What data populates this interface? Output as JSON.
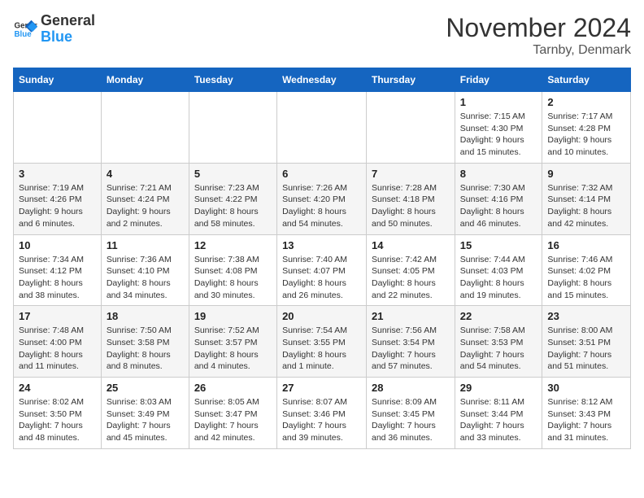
{
  "header": {
    "logo_general": "General",
    "logo_blue": "Blue",
    "month": "November 2024",
    "location": "Tarnby, Denmark"
  },
  "days_of_week": [
    "Sunday",
    "Monday",
    "Tuesday",
    "Wednesday",
    "Thursday",
    "Friday",
    "Saturday"
  ],
  "weeks": [
    [
      {
        "day": "",
        "info": ""
      },
      {
        "day": "",
        "info": ""
      },
      {
        "day": "",
        "info": ""
      },
      {
        "day": "",
        "info": ""
      },
      {
        "day": "",
        "info": ""
      },
      {
        "day": "1",
        "info": "Sunrise: 7:15 AM\nSunset: 4:30 PM\nDaylight: 9 hours and 15 minutes."
      },
      {
        "day": "2",
        "info": "Sunrise: 7:17 AM\nSunset: 4:28 PM\nDaylight: 9 hours and 10 minutes."
      }
    ],
    [
      {
        "day": "3",
        "info": "Sunrise: 7:19 AM\nSunset: 4:26 PM\nDaylight: 9 hours and 6 minutes."
      },
      {
        "day": "4",
        "info": "Sunrise: 7:21 AM\nSunset: 4:24 PM\nDaylight: 9 hours and 2 minutes."
      },
      {
        "day": "5",
        "info": "Sunrise: 7:23 AM\nSunset: 4:22 PM\nDaylight: 8 hours and 58 minutes."
      },
      {
        "day": "6",
        "info": "Sunrise: 7:26 AM\nSunset: 4:20 PM\nDaylight: 8 hours and 54 minutes."
      },
      {
        "day": "7",
        "info": "Sunrise: 7:28 AM\nSunset: 4:18 PM\nDaylight: 8 hours and 50 minutes."
      },
      {
        "day": "8",
        "info": "Sunrise: 7:30 AM\nSunset: 4:16 PM\nDaylight: 8 hours and 46 minutes."
      },
      {
        "day": "9",
        "info": "Sunrise: 7:32 AM\nSunset: 4:14 PM\nDaylight: 8 hours and 42 minutes."
      }
    ],
    [
      {
        "day": "10",
        "info": "Sunrise: 7:34 AM\nSunset: 4:12 PM\nDaylight: 8 hours and 38 minutes."
      },
      {
        "day": "11",
        "info": "Sunrise: 7:36 AM\nSunset: 4:10 PM\nDaylight: 8 hours and 34 minutes."
      },
      {
        "day": "12",
        "info": "Sunrise: 7:38 AM\nSunset: 4:08 PM\nDaylight: 8 hours and 30 minutes."
      },
      {
        "day": "13",
        "info": "Sunrise: 7:40 AM\nSunset: 4:07 PM\nDaylight: 8 hours and 26 minutes."
      },
      {
        "day": "14",
        "info": "Sunrise: 7:42 AM\nSunset: 4:05 PM\nDaylight: 8 hours and 22 minutes."
      },
      {
        "day": "15",
        "info": "Sunrise: 7:44 AM\nSunset: 4:03 PM\nDaylight: 8 hours and 19 minutes."
      },
      {
        "day": "16",
        "info": "Sunrise: 7:46 AM\nSunset: 4:02 PM\nDaylight: 8 hours and 15 minutes."
      }
    ],
    [
      {
        "day": "17",
        "info": "Sunrise: 7:48 AM\nSunset: 4:00 PM\nDaylight: 8 hours and 11 minutes."
      },
      {
        "day": "18",
        "info": "Sunrise: 7:50 AM\nSunset: 3:58 PM\nDaylight: 8 hours and 8 minutes."
      },
      {
        "day": "19",
        "info": "Sunrise: 7:52 AM\nSunset: 3:57 PM\nDaylight: 8 hours and 4 minutes."
      },
      {
        "day": "20",
        "info": "Sunrise: 7:54 AM\nSunset: 3:55 PM\nDaylight: 8 hours and 1 minute."
      },
      {
        "day": "21",
        "info": "Sunrise: 7:56 AM\nSunset: 3:54 PM\nDaylight: 7 hours and 57 minutes."
      },
      {
        "day": "22",
        "info": "Sunrise: 7:58 AM\nSunset: 3:53 PM\nDaylight: 7 hours and 54 minutes."
      },
      {
        "day": "23",
        "info": "Sunrise: 8:00 AM\nSunset: 3:51 PM\nDaylight: 7 hours and 51 minutes."
      }
    ],
    [
      {
        "day": "24",
        "info": "Sunrise: 8:02 AM\nSunset: 3:50 PM\nDaylight: 7 hours and 48 minutes."
      },
      {
        "day": "25",
        "info": "Sunrise: 8:03 AM\nSunset: 3:49 PM\nDaylight: 7 hours and 45 minutes."
      },
      {
        "day": "26",
        "info": "Sunrise: 8:05 AM\nSunset: 3:47 PM\nDaylight: 7 hours and 42 minutes."
      },
      {
        "day": "27",
        "info": "Sunrise: 8:07 AM\nSunset: 3:46 PM\nDaylight: 7 hours and 39 minutes."
      },
      {
        "day": "28",
        "info": "Sunrise: 8:09 AM\nSunset: 3:45 PM\nDaylight: 7 hours and 36 minutes."
      },
      {
        "day": "29",
        "info": "Sunrise: 8:11 AM\nSunset: 3:44 PM\nDaylight: 7 hours and 33 minutes."
      },
      {
        "day": "30",
        "info": "Sunrise: 8:12 AM\nSunset: 3:43 PM\nDaylight: 7 hours and 31 minutes."
      }
    ]
  ]
}
